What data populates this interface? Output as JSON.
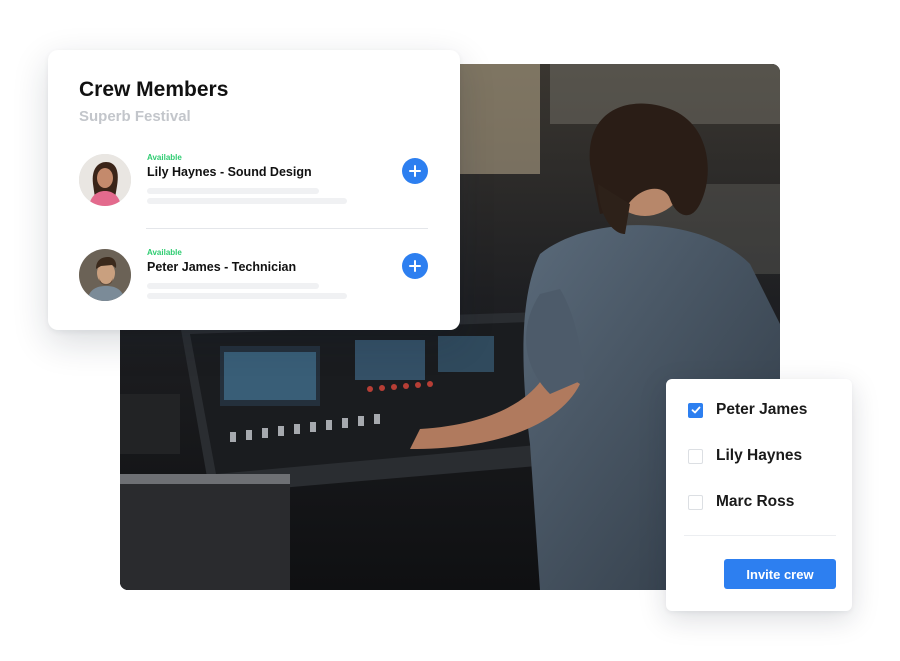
{
  "crew_card": {
    "title": "Crew Members",
    "subtitle": "Superb Festival",
    "members": [
      {
        "status": "Available",
        "name": "Lily Haynes - Sound Design",
        "avatar": "woman-portrait"
      },
      {
        "status": "Available",
        "name": "Peter James - Technician",
        "avatar": "man-portrait"
      }
    ],
    "add_icon": "plus-circle-icon"
  },
  "invite_card": {
    "options": [
      {
        "label": "Peter James",
        "checked": true
      },
      {
        "label": "Lily Haynes",
        "checked": false
      },
      {
        "label": "Marc Ross",
        "checked": false
      }
    ],
    "button_label": "Invite crew"
  },
  "colors": {
    "accent": "#2d7ff0",
    "available": "#2ecc71",
    "subtitle": "#c3c6cb"
  }
}
